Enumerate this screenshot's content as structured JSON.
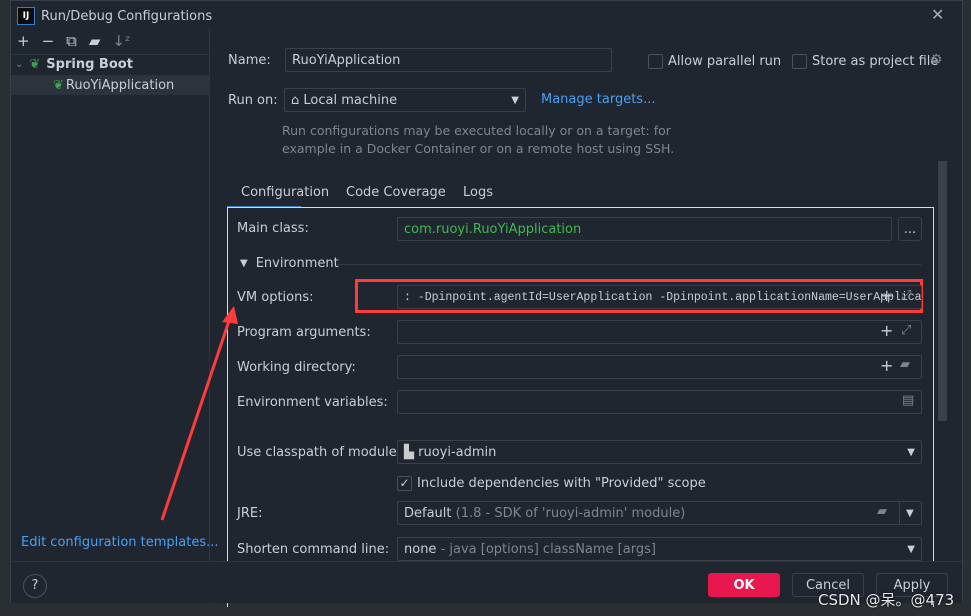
{
  "window": {
    "title": "Run/Debug Configurations",
    "logo": "IJ"
  },
  "toolbar": {
    "icons": [
      "plus-icon",
      "minus-icon",
      "copy-icon",
      "new-folder-icon",
      "sort-icon"
    ]
  },
  "tree": {
    "group": "Spring Boot",
    "item": "RuoYiApplication"
  },
  "sidebar": {
    "edit_templates": "Edit configuration templates..."
  },
  "form": {
    "name_label": "Name:",
    "name_value": "RuoYiApplication",
    "allow_parallel": "Allow parallel run",
    "store_project": "Store as project file",
    "run_on_label": "Run on:",
    "run_on_value": "Local machine",
    "manage_targets": "Manage targets...",
    "hint_line1": "Run configurations may be executed locally or on a target: for",
    "hint_line2": "example in a Docker Container or on a remote host using SSH."
  },
  "tabs": [
    "Configuration",
    "Code Coverage",
    "Logs"
  ],
  "config": {
    "main_class_label": "Main class:",
    "main_class_value": "com.ruoyi.RuoYiApplication",
    "browse": "...",
    "environment": "Environment",
    "vm_label": "VM options:",
    "vm_value": ": -Dpinpoint.agentId=UserApplication -Dpinpoint.applicationName=UserApplication",
    "prog_label": "Program arguments:",
    "workdir_label": "Working directory:",
    "env_label": "Environment variables:",
    "classpath_label": "Use classpath of module:",
    "classpath_value": "ruoyi-admin",
    "include_deps": "Include dependencies with \"Provided\" scope",
    "include_deps_checked": true,
    "jre_label": "JRE:",
    "jre_value": "Default",
    "jre_detail": "(1.8 - SDK of 'ruoyi-admin' module)",
    "shorten_label": "Shorten command line:",
    "shorten_value": "none",
    "shorten_detail": "- java [options] className [args]"
  },
  "buttons": {
    "help": "?",
    "ok": "OK",
    "cancel": "Cancel",
    "apply": "Apply"
  },
  "watermark": "CSDN @呆。@473",
  "colors": {
    "accent": "#e8184f",
    "link": "#4a9ff5",
    "class_green": "#3fb950",
    "highlight": "#ff3b3b"
  }
}
